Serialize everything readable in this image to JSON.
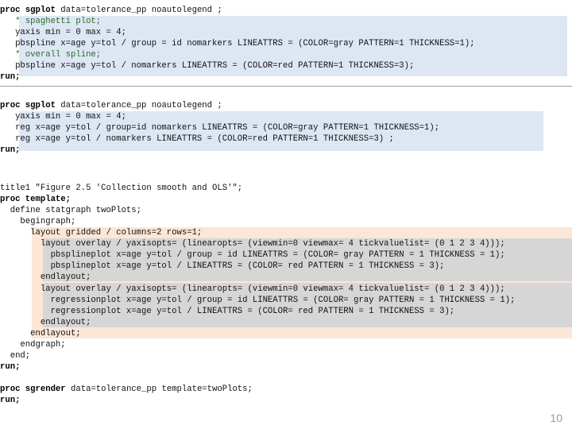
{
  "block1": {
    "lines": [
      {
        "kw": "proc sgplot",
        "text": " data=tolerance_pp noautolegend ;"
      },
      {
        "text": "   * spaghetti plot;"
      },
      {
        "text": "   yaxis min = 0 max = 4;"
      },
      {
        "text": "   pbspline x=age y=tol / group = id nomarkers LINEATTRS = (COLOR=gray PATTERN=1 THICKNESS=1);"
      },
      {
        "text": "   * overall spline;"
      },
      {
        "text": "   pbspline x=age y=tol / nomarkers LINEATTRS = (COLOR=red PATTERN=1 THICKNESS=3);"
      },
      {
        "kw": "run;",
        "text": ""
      }
    ]
  },
  "block2": {
    "lines": [
      {
        "kw": "proc sgplot",
        "text": " data=tolerance_pp noautolegend ;"
      },
      {
        "text": "   yaxis min = 0 max = 4;"
      },
      {
        "text": "   reg x=age y=tol / group=id nomarkers LINEATTRS = (COLOR=gray PATTERN=1 THICKNESS=1);"
      },
      {
        "text": "   reg x=age y=tol / nomarkers LINEATTRS = (COLOR=red PATTERN=1 THICKNESS=3) ;"
      },
      {
        "kw": "run;",
        "text": ""
      }
    ]
  },
  "block3": {
    "lines": [
      {
        "text": "title1 \"Figure 2.5 'Collection smooth and OLS'\";"
      },
      {
        "kw": "proc template;",
        "text": ""
      },
      {
        "text": "  define statgraph twoPlots;"
      },
      {
        "text": "    begingraph;"
      },
      {
        "text": "      layout gridded / columns=2 rows=1;"
      },
      {
        "text": "        layout overlay / yaxisopts= (linearopts= (viewmin=0 viewmax= 4 tickvaluelist= (0 1 2 3 4)));"
      },
      {
        "text": "          pbsplineplot x=age y=tol / group = id LINEATTRS = (COLOR= gray PATTERN = 1 THICKNESS = 1);"
      },
      {
        "text": "          pbsplineplot x=age y=tol / LINEATTRS = (COLOR= red PATTERN = 1 THICKNESS = 3);"
      },
      {
        "text": "        endlayout;"
      },
      {
        "text": "        layout overlay / yaxisopts= (linearopts= (viewmin=0 viewmax= 4 tickvaluelist= (0 1 2 3 4)));"
      },
      {
        "text": "          regressionplot x=age y=tol / group = id LINEATTRS = (COLOR= gray PATTERN = 1 THICKNESS = 1);"
      },
      {
        "text": "          regressionplot x=age y=tol / LINEATTRS = (COLOR= red PATTERN = 1 THICKNESS = 3);"
      },
      {
        "text": "        endlayout;"
      },
      {
        "text": "      endlayout;"
      },
      {
        "text": "    endgraph;"
      },
      {
        "text": "  end;"
      },
      {
        "kw": "run;",
        "text": ""
      }
    ]
  },
  "block4": {
    "lines": [
      {
        "kw": "proc sgrender",
        "text": " data=tolerance_pp template=twoPlots;"
      },
      {
        "kw": "run;",
        "text": ""
      }
    ]
  },
  "page_number": "10"
}
